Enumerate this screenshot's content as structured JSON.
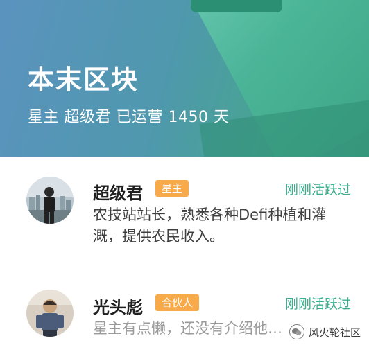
{
  "header": {
    "title": "本末区块",
    "subtitle": "星主 超级君 已运营 1450 天"
  },
  "members": [
    {
      "name": "超级君",
      "role": "星主",
      "activity": "刚刚活跃过",
      "description": "农技站站长，熟悉各种Defi种植和灌溉，提供农民收入。"
    },
    {
      "name": "光头彪",
      "role": "合伙人",
      "activity": "刚刚活跃过",
      "description": "星主有点懒，还没有介绍他…"
    }
  ],
  "watermark": {
    "text": "风火轮社区",
    "icon": "wechat-icon"
  },
  "colors": {
    "accent": "#3aae8e",
    "badge": "#f8a94a"
  }
}
